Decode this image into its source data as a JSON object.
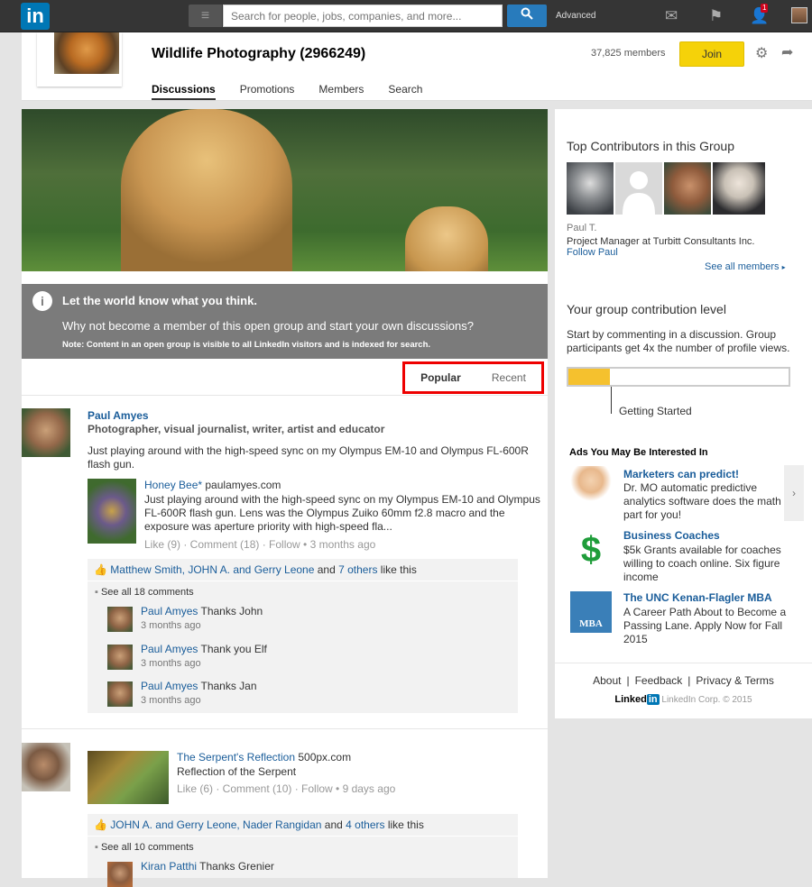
{
  "topbar": {
    "logo": "in",
    "search_placeholder": "Search for people, jobs, companies, and more...",
    "advanced": "Advanced",
    "notification_count": "1"
  },
  "group": {
    "title": "Wildlife Photography (2966249)",
    "members": "37,825 members",
    "join": "Join",
    "tabs": [
      "Discussions",
      "Promotions",
      "Members",
      "Search"
    ]
  },
  "info_box": {
    "icon": "i",
    "heading": "Let the world know what you think.",
    "text": "Why not become a member of this open group and start your own discussions?",
    "note": "Note: Content in an open group is visible to all LinkedIn visitors and is indexed for search."
  },
  "sort": {
    "popular": "Popular",
    "recent": "Recent"
  },
  "posts": [
    {
      "author": "Paul Amyes",
      "headline": "Photographer, visual journalist, writer, artist and educator",
      "text": "Just playing around with the high-speed sync on my Olympus EM-10 and Olympus FL-600R flash gun.",
      "link_title": "Honey Bee*",
      "link_source": " paulamyes.com",
      "link_desc": "Just playing around with the high-speed sync on my Olympus EM-10 and Olympus FL-600R flash gun. Lens was the Olympus Zuiko 60mm f2.8 macro and the exposure was aperture priority with high-speed fla...",
      "meta": "Like (9) · Comment (18) · Follow • 3 months ago",
      "likes_names": "Matthew Smith, JOHN A. and Gerry Leone",
      "likes_and": " and ",
      "likes_others": "7 others",
      "likes_suffix": " like this",
      "see_all": "See all 18 comments",
      "comments": [
        {
          "name": "Paul Amyes",
          "text": " Thanks John",
          "time": "3 months ago"
        },
        {
          "name": "Paul Amyes",
          "text": " Thank you Elf",
          "time": "3 months ago"
        },
        {
          "name": "Paul Amyes",
          "text": " Thanks Jan",
          "time": "3 months ago"
        }
      ]
    },
    {
      "link_title": "The Serpent's Reflection",
      "link_source": " 500px.com",
      "link_desc": "Reflection of the Serpent",
      "meta": "Like (6) · Comment (10) · Follow • 9 days ago",
      "likes_names": "JOHN A. and Gerry Leone, Nader Rangidan",
      "likes_and": " and ",
      "likes_others": "4 others",
      "likes_suffix": " like this",
      "see_all": "See all 10 comments",
      "comments": [
        {
          "name": "Kiran Patthi",
          "text": " Thanks Grenier"
        }
      ]
    }
  ],
  "sidebar": {
    "top_contributors_title": "Top Contributors in this Group",
    "contributor_name": "Paul T.",
    "contributor_title": "Project Manager at Turbitt Consultants Inc.",
    "follow": "Follow Paul",
    "see_all_members": "See all members",
    "contribution_title": "Your group contribution level",
    "contribution_text": "Start by commenting in a discussion. Group participants get 4x the number of profile views.",
    "level_label": "Getting Started",
    "contribution_progress": 0.19
  },
  "ads": {
    "title": "Ads You May Be Interested In",
    "items": [
      {
        "title": "Marketers can predict!",
        "desc": "Dr. MO automatic predictive analytics software does the math part for you!"
      },
      {
        "title": "Business Coaches",
        "desc": "$5k Grants available for coaches willing to coach online. Six figure income"
      },
      {
        "title": "The UNC Kenan-Flagler MBA",
        "desc": "A Career Path About to Become a Passing Lane. Apply Now for Fall 2015",
        "badge": "MBA"
      }
    ]
  },
  "footer": {
    "about": "About",
    "feedback": "Feedback",
    "privacy": "Privacy & Terms",
    "brand": "Linked",
    "brand_in": "in",
    "copyright": "LinkedIn Corp. © 2015"
  }
}
